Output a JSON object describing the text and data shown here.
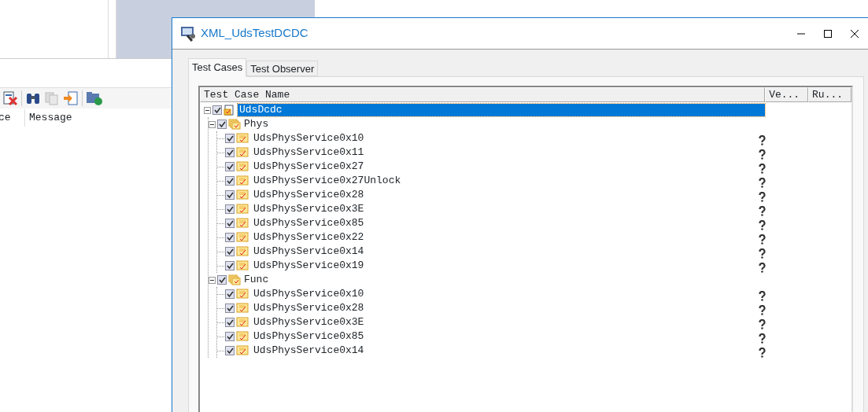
{
  "background_app": {
    "columns": [
      "ce",
      "Message"
    ]
  },
  "dialog": {
    "title": "XML_UdsTestDCDC",
    "tabs": [
      {
        "label": "Test Cases",
        "selected": true
      },
      {
        "label": "Test Observer",
        "selected": false
      }
    ],
    "tree": {
      "columns": [
        "Test Case Name",
        "Ve...",
        "Ru..."
      ],
      "root": {
        "name": "UdsDcdc",
        "kind": "root",
        "checked": true,
        "selected": true,
        "expanded": true,
        "children": [
          {
            "name": "Phys",
            "kind": "group",
            "checked": true,
            "selected": false,
            "expanded": true,
            "children": [
              {
                "name": "UdsPhysService0x10",
                "kind": "test",
                "checked": true,
                "selected": false
              },
              {
                "name": "UdsPhysService0x11",
                "kind": "test",
                "checked": true,
                "selected": false
              },
              {
                "name": "UdsPhysService0x27",
                "kind": "test",
                "checked": true,
                "selected": false
              },
              {
                "name": "UdsPhysService0x27Unlock",
                "kind": "test",
                "checked": true,
                "selected": false
              },
              {
                "name": "UdsPhysService0x28",
                "kind": "test",
                "checked": true,
                "selected": false
              },
              {
                "name": "UdsPhysService0x3E",
                "kind": "test",
                "checked": true,
                "selected": false
              },
              {
                "name": "UdsPhysService0x85",
                "kind": "test",
                "checked": true,
                "selected": false
              },
              {
                "name": "UdsPhysService0x22",
                "kind": "test",
                "checked": true,
                "selected": false
              },
              {
                "name": "UdsPhysService0x14",
                "kind": "test",
                "checked": true,
                "selected": false
              },
              {
                "name": "UdsPhysService0x19",
                "kind": "test",
                "checked": true,
                "selected": false
              }
            ]
          },
          {
            "name": "Func",
            "kind": "group",
            "checked": true,
            "selected": false,
            "expanded": true,
            "children": [
              {
                "name": "UdsPhysService0x10",
                "kind": "test",
                "checked": true,
                "selected": false
              },
              {
                "name": "UdsPhysService0x28",
                "kind": "test",
                "checked": true,
                "selected": false
              },
              {
                "name": "UdsPhysService0x3E",
                "kind": "test",
                "checked": true,
                "selected": false
              },
              {
                "name": "UdsPhysService0x85",
                "kind": "test",
                "checked": true,
                "selected": false
              },
              {
                "name": "UdsPhysService0x14",
                "kind": "test",
                "checked": true,
                "selected": false
              }
            ]
          }
        ]
      }
    }
  }
}
